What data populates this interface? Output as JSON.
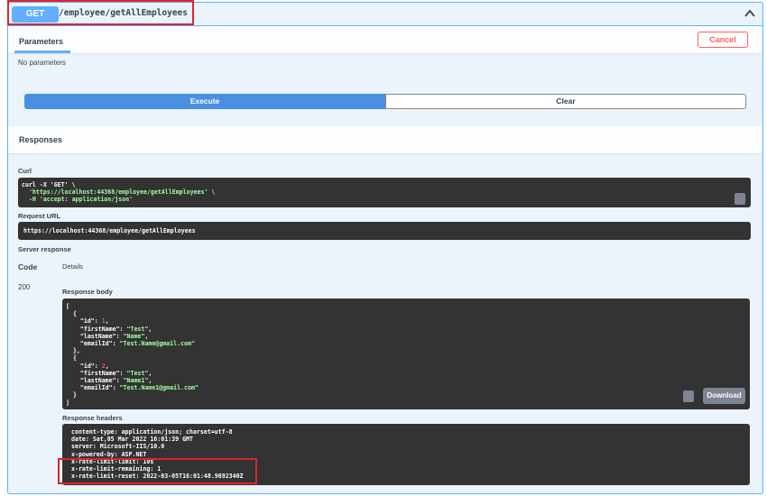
{
  "operation": {
    "method": "GET",
    "path": "/employee/getAllEmployees"
  },
  "parameters": {
    "tab_label": "Parameters",
    "cancel_label": "Cancel",
    "empty_text": "No parameters"
  },
  "actions": {
    "execute_label": "Execute",
    "clear_label": "Clear"
  },
  "responses": {
    "title": "Responses",
    "curl_label": "Curl",
    "curl_lines": [
      "curl -X 'GET' \\",
      "  'https://localhost:44368/employee/getAllEmployees' \\",
      "  -H 'accept: application/json'"
    ],
    "request_url_label": "Request URL",
    "request_url": "https://localhost:44368/employee/getAllEmployees",
    "server_response_label": "Server response",
    "code_header": "Code",
    "details_header": "Details",
    "status_code": "200",
    "response_body_label": "Response body",
    "body_employees": [
      {
        "id": "1",
        "firstName": "\"Test\"",
        "lastName": "\"Name\"",
        "emailId": "\"Test.Name@gmail.com\""
      },
      {
        "id": "2",
        "firstName": "\"Test\"",
        "lastName": "\"Name1\"",
        "emailId": "\"Test.Name1@gmail.com\""
      }
    ],
    "download_label": "Download",
    "response_headers_label": "Response headers",
    "headers": [
      "content-type: application/json; charset=utf-8",
      "date: Sat,05 Mar 2022 16:01:39 GMT",
      "server: Microsoft-IIS/10.0",
      "x-powered-by: ASP.NET",
      "x-rate-limit-limit: 10s",
      "x-rate-limit-remaining: 1",
      "x-rate-limit-reset: 2022-03-05T16:01:48.9692340Z"
    ]
  },
  "colors": {
    "get_blue": "#61affe",
    "execute_blue": "#4990e2",
    "cancel_red": "#ff6060",
    "highlight_red": "#d9262c",
    "code_bg": "#333333"
  }
}
